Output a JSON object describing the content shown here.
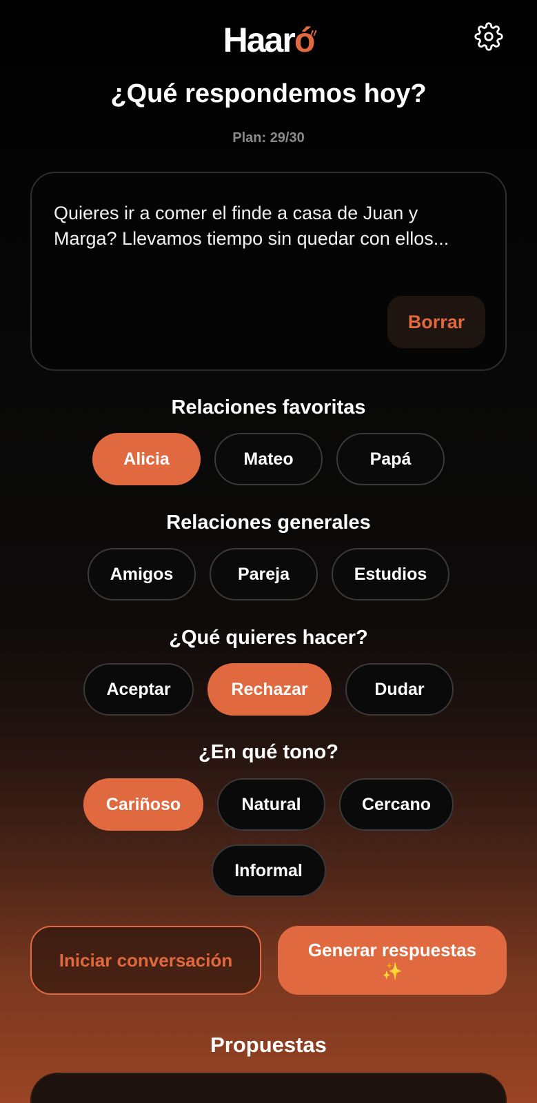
{
  "app": {
    "logo_text": "Haaró",
    "settings_icon": "gear-icon"
  },
  "header": {
    "title": "¿Qué respondemos hoy?",
    "plan": "Plan: 29/30"
  },
  "message": {
    "text": "Quieres ir a comer el finde a casa de Juan y Marga? Llevamos tiempo sin quedar con ellos...",
    "clear_label": "Borrar"
  },
  "favorites": {
    "title": "Relaciones favoritas",
    "chips": [
      {
        "label": "Alicia",
        "selected": true
      },
      {
        "label": "Mateo",
        "selected": false
      },
      {
        "label": "Papá",
        "selected": false
      }
    ]
  },
  "general": {
    "title": "Relaciones generales",
    "chips": [
      {
        "label": "Amigos",
        "selected": false
      },
      {
        "label": "Pareja",
        "selected": false
      },
      {
        "label": "Estudios",
        "selected": false
      }
    ]
  },
  "intent": {
    "title": "¿Qué quieres hacer?",
    "chips": [
      {
        "label": "Aceptar",
        "selected": false
      },
      {
        "label": "Rechazar",
        "selected": true
      },
      {
        "label": "Dudar",
        "selected": false
      }
    ]
  },
  "tone": {
    "title": "¿En qué tono?",
    "chips": [
      {
        "label": "Cariñoso",
        "selected": true
      },
      {
        "label": "Natural",
        "selected": false
      },
      {
        "label": "Cercano",
        "selected": false
      },
      {
        "label": "Informal",
        "selected": false
      }
    ]
  },
  "actions": {
    "start_label": "Iniciar conversación",
    "generate_label": "Generar respuestas",
    "generate_emoji": "✨"
  },
  "proposals": {
    "title": "Propuestas"
  },
  "colors": {
    "accent": "#e0693f",
    "background": "#000000",
    "chip_border": "#3a3a3a"
  }
}
